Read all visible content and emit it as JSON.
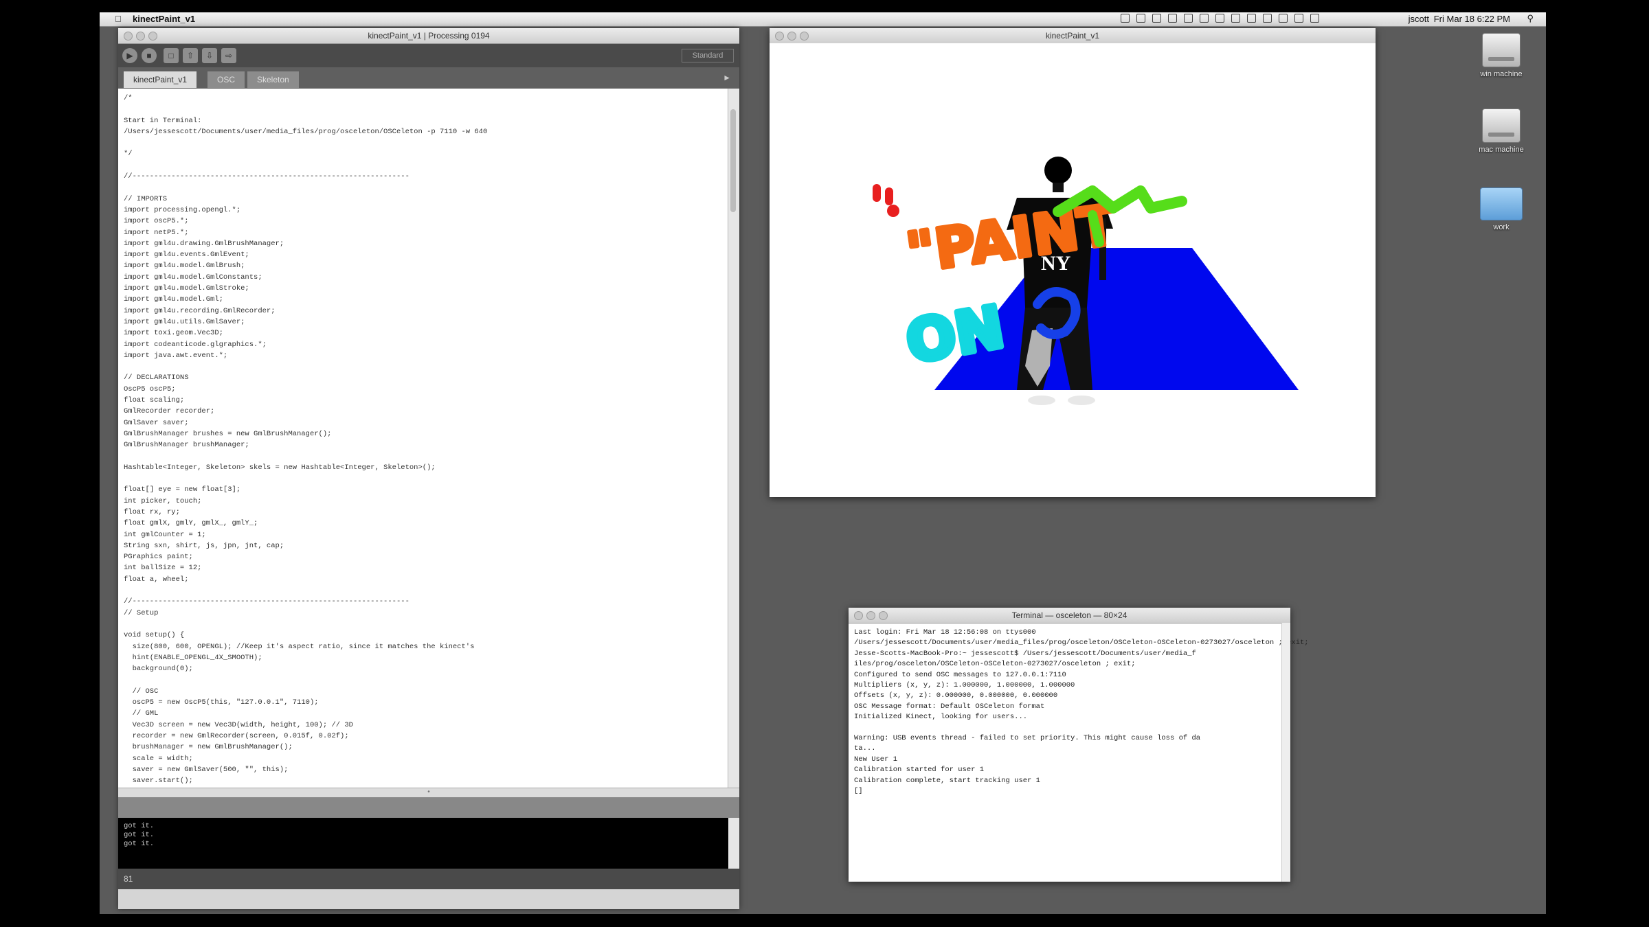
{
  "menubar": {
    "app_name": "kinectPaint_v1",
    "user": "jscott",
    "clock": "Fri Mar 18  6:22 PM"
  },
  "ide": {
    "window_title": "kinectPaint_v1 | Processing 0194",
    "mode": "Standard",
    "tabs": [
      {
        "label": "kinectPaint_v1"
      },
      {
        "label": "OSC"
      },
      {
        "label": "Skeleton"
      }
    ],
    "code": "/*\n\nStart in Terminal:\n/Users/jessescott/Documents/user/media_files/prog/osceleton/OSCeleton -p 7110 -w 640\n\n*/\n\n//----------------------------------------------------------------\n\n// IMPORTS\nimport processing.opengl.*;\nimport oscP5.*;\nimport netP5.*;\nimport gml4u.drawing.GmlBrushManager;\nimport gml4u.events.GmlEvent;\nimport gml4u.model.GmlBrush;\nimport gml4u.model.GmlConstants;\nimport gml4u.model.GmlStroke;\nimport gml4u.model.Gml;\nimport gml4u.recording.GmlRecorder;\nimport gml4u.utils.GmlSaver;\nimport toxi.geom.Vec3D;\nimport codeanticode.glgraphics.*;\nimport java.awt.event.*;\n\n// DECLARATIONS\nOscP5 oscP5;\nfloat scaling;\nGmlRecorder recorder;\nGmlSaver saver;\nGmlBrushManager brushes = new GmlBrushManager();\nGmlBrushManager brushManager;\n\nHashtable<Integer, Skeleton> skels = new Hashtable<Integer, Skeleton>();\n\nfloat[] eye = new float[3];\nint picker, touch;\nfloat rx, ry;\nfloat gmlX, gmlY, gmlX_, gmlY_;\nint gmlCounter = 1;\nString sxn, shirt, js, jpn, jnt, cap;\nPGraphics paint;\nint ballSize = 12;\nfloat a, wheel;\n\n//----------------------------------------------------------------\n// Setup\n\nvoid setup() {\n  size(800, 600, OPENGL); //Keep it's aspect ratio, since it matches the kinect's\n  hint(ENABLE_OPENGL_4X_SMOOTH);\n  background(0);\n\n  // OSC\n  oscP5 = new OscP5(this, \"127.0.0.1\", 7110);\n  // GML\n  Vec3D screen = new Vec3D(width, height, 100); // 3D\n  recorder = new GmlRecorder(screen, 0.015f, 0.02f);\n  brushManager = new GmlBrushManager();\n  scale = width;\n  saver = new GmlSaver(500, \"\", this);\n  saver.start();",
    "console": "got it.\ngot it.\ngot it.",
    "line_number": "81"
  },
  "sketch": {
    "window_title": "kinectPaint_v1",
    "graffiti_1": "\"PAINT",
    "graffiti_2": "ON",
    "shirt_text": "NY",
    "colors": {
      "floor": "#0008ee",
      "cyan": "#13d7e0",
      "orange": "#f46a12",
      "green": "#56dd1a",
      "red": "#e81f1f",
      "blue_stroke": "#1640e8"
    }
  },
  "terminal": {
    "window_title": "Terminal — osceleton — 80×24",
    "content": "Last login: Fri Mar 18 12:56:08 on ttys000\n/Users/jessescott/Documents/user/media_files/prog/osceleton/OSCeleton-OSCeleton-0273027/osceleton ; exit;\nJesse-Scotts-MacBook-Pro:~ jessescott$ /Users/jessescott/Documents/user/media_f\niles/prog/osceleton/OSCeleton-OSCeleton-0273027/osceleton ; exit;\nConfigured to send OSC messages to 127.0.0.1:7110\nMultipliers (x, y, z): 1.000000, 1.000000, 1.000000\nOffsets (x, y, z): 0.000000, 0.000000, 0.000000\nOSC Message format: Default OSCeleton format\nInitialized Kinect, looking for users...\n\nWarning: USB events thread - failed to set priority. This might cause loss of da\nta...\nNew User 1\nCalibration started for user 1\nCalibration complete, start tracking user 1\n[]"
  },
  "desktop": {
    "icons": [
      {
        "label": "win machine"
      },
      {
        "label": "mac machine"
      },
      {
        "label": "work"
      }
    ]
  }
}
